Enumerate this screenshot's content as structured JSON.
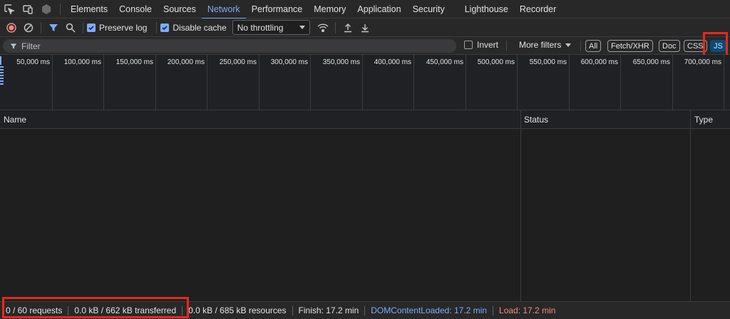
{
  "tabs": [
    {
      "label": "Elements"
    },
    {
      "label": "Console"
    },
    {
      "label": "Sources"
    },
    {
      "label": "Network",
      "active": true
    },
    {
      "label": "Performance"
    },
    {
      "label": "Memory"
    },
    {
      "label": "Application"
    },
    {
      "label": "Security"
    },
    {
      "label": "Lighthouse"
    },
    {
      "label": "Recorder"
    }
  ],
  "toolbar": {
    "preserve_log_label": "Preserve log",
    "preserve_log_checked": true,
    "disable_cache_label": "Disable cache",
    "disable_cache_checked": true,
    "throttling_value": "No throttling"
  },
  "filter": {
    "placeholder": "Filter",
    "invert_label": "Invert",
    "more_filters_label": "More filters",
    "chips": [
      {
        "label": "All"
      },
      {
        "label": "Fetch/XHR"
      },
      {
        "label": "Doc"
      },
      {
        "label": "CSS"
      },
      {
        "label": "JS",
        "active": true
      }
    ]
  },
  "overview": {
    "ticks": [
      "50,000 ms",
      "100,000 ms",
      "150,000 ms",
      "200,000 ms",
      "250,000 ms",
      "300,000 ms",
      "350,000 ms",
      "400,000 ms",
      "450,000 ms",
      "500,000 ms",
      "550,000 ms",
      "600,000 ms",
      "650,000 ms",
      "700,000 ms"
    ]
  },
  "table": {
    "columns": [
      "Name",
      "Status",
      "Type"
    ]
  },
  "status": {
    "requests": "0 / 60 requests",
    "transferred": "0.0 kB / 662 kB transferred",
    "resources": "0.0 kB / 685 kB resources",
    "finish": "Finish: 17.2 min",
    "dom_content_loaded": "DOMContentLoaded: 17.2 min",
    "load": "Load: 17.2 min"
  },
  "colors": {
    "accent": "#7cacf8",
    "highlight_box": "#e8281c",
    "load_text": "#f28b82",
    "active_chip_bg": "#0b4a75"
  }
}
